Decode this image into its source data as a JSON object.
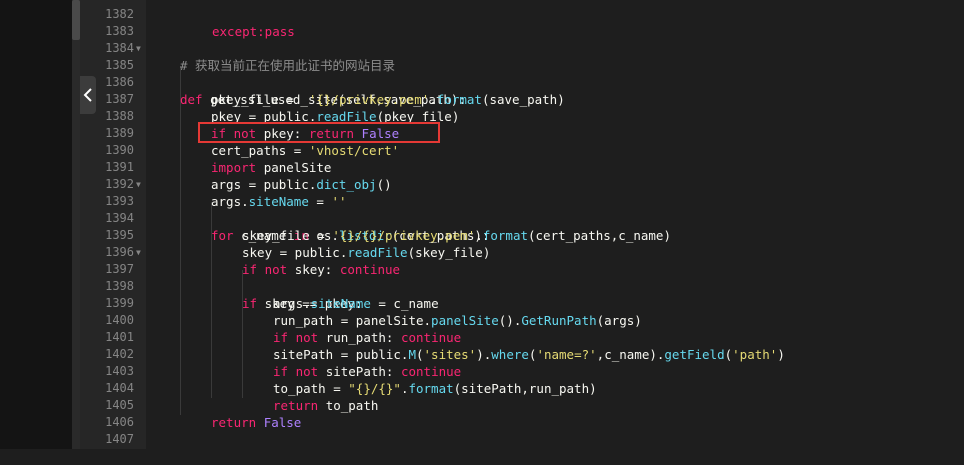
{
  "editor": {
    "line_numbers": [
      "1382",
      "1383",
      "1384",
      "1385",
      "1386",
      "1387",
      "1388",
      "1389",
      "1390",
      "1391",
      "1392",
      "1393",
      "1394",
      "1395",
      "1396",
      "1397",
      "1398",
      "1399",
      "1400",
      "1401",
      "1402",
      "1403",
      "1404",
      "1405",
      "1406",
      "1407"
    ],
    "top_partial": "except:pass",
    "comment": "# 获取当前正在使用此证书的网站目录",
    "def_kw": "def",
    "def_name": "get_ssl_used_site",
    "def_args": "(self,save_path):",
    "l1386": {
      "a": "pkey_file = ",
      "b": "'{}/privkey.pem'",
      "c": ".",
      "d": "format",
      "e": "(save_path)"
    },
    "l1387": {
      "a": "pkey = public.",
      "b": "readFile",
      "c": "(pkey_file)"
    },
    "l1388": {
      "a": "if not ",
      "b": "pkey",
      "c": ": ",
      "d": "return ",
      "e": "False"
    },
    "l1389": {
      "a": "cert_paths",
      "b": " = ",
      "c": "'vhost/cert'"
    },
    "l1390": {
      "a": "import ",
      "b": "panelSite"
    },
    "l1391": {
      "a": "args = public.",
      "b": "dict_obj",
      "c": "()"
    },
    "l1392": {
      "a": "args.",
      "b": "siteName",
      "c": " = ",
      "d": "''"
    },
    "l1393": {
      "a": "for ",
      "b": "c_name",
      "c": " in ",
      "d": "os.",
      "e": "listdir",
      "f": "(cert_paths):"
    },
    "l1394": {
      "a": "skey_file = ",
      "b": "'{}/{}/privkey.pem'",
      "c": ".",
      "d": "format",
      "e": "(cert_paths,c_name)"
    },
    "l1395": {
      "a": "skey = public.",
      "b": "readFile",
      "c": "(skey_file)"
    },
    "l1396": {
      "a": "if not ",
      "b": "skey",
      "c": ": ",
      "d": "continue"
    },
    "l1397": {
      "a": "if ",
      "b": "skey == pkey:"
    },
    "l1398": {
      "a": "args.",
      "b": "siteName",
      "c": " = c_name"
    },
    "l1399": {
      "a": "run_path = panelSite.",
      "b": "panelSite",
      "c": "().",
      "d": "GetRunPath",
      "e": "(args)"
    },
    "l1400": {
      "a": "if not ",
      "b": "run_path",
      "c": ": ",
      "d": "continue"
    },
    "l1401": {
      "a": "sitePath = public.",
      "b": "M",
      "c": "(",
      "d": "'sites'",
      "e": ").",
      "f": "where",
      "g": "(",
      "h": "'name=?'",
      "i": ",c_name).",
      "j": "getField",
      "k": "(",
      "l": "'path'",
      "m": ")"
    },
    "l1402": {
      "a": "if not ",
      "b": "sitePath",
      "c": ": ",
      "d": "continue"
    },
    "l1403": {
      "a": "to_path = ",
      "b": "\"{}/{}\"",
      "c": ".",
      "d": "format",
      "e": "(sitePath,run_path)"
    },
    "l1404": {
      "a": "return ",
      "b": "to_path"
    },
    "l1405": {
      "a": "return ",
      "b": "False"
    }
  },
  "colors": {
    "keyword": "#f92672",
    "function": "#66d9ef",
    "string": "#e6db74",
    "comment": "#8c8c8c",
    "highlight_box": "#e53935"
  },
  "icons": {
    "collapse": "chevron-left-icon",
    "fold": "fold-arrow-icon"
  }
}
